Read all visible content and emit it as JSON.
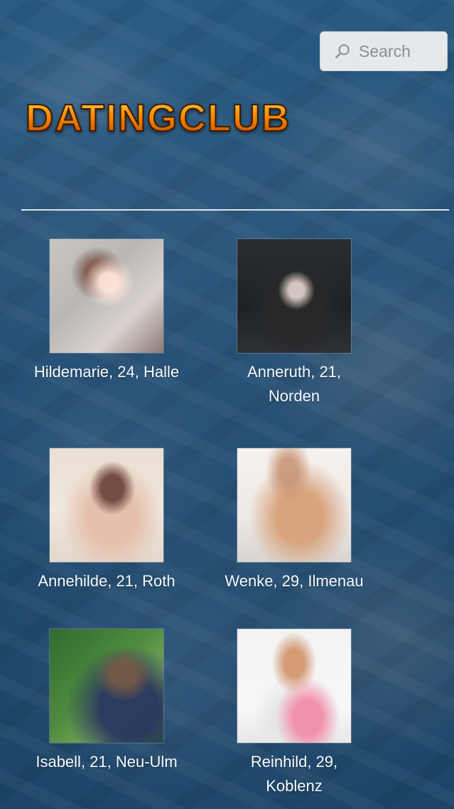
{
  "search": {
    "label": "Search",
    "icon": "search-icon"
  },
  "brand": {
    "logo_text": "DATINGCLUB"
  },
  "profiles": [
    {
      "caption": "Hildemarie, 24, Halle"
    },
    {
      "caption": "Anneruth, 21, Norden"
    },
    {
      "caption": "Annehilde, 21, Roth"
    },
    {
      "caption": "Wenke, 29, Ilmenau"
    },
    {
      "caption": "Isabell, 21, Neu-Ulm"
    },
    {
      "caption": "Reinhild, 29, Koblenz"
    }
  ],
  "colors": {
    "background": "#214d72",
    "logo_orange": "#ff8a00",
    "text": "#f7fbff"
  }
}
